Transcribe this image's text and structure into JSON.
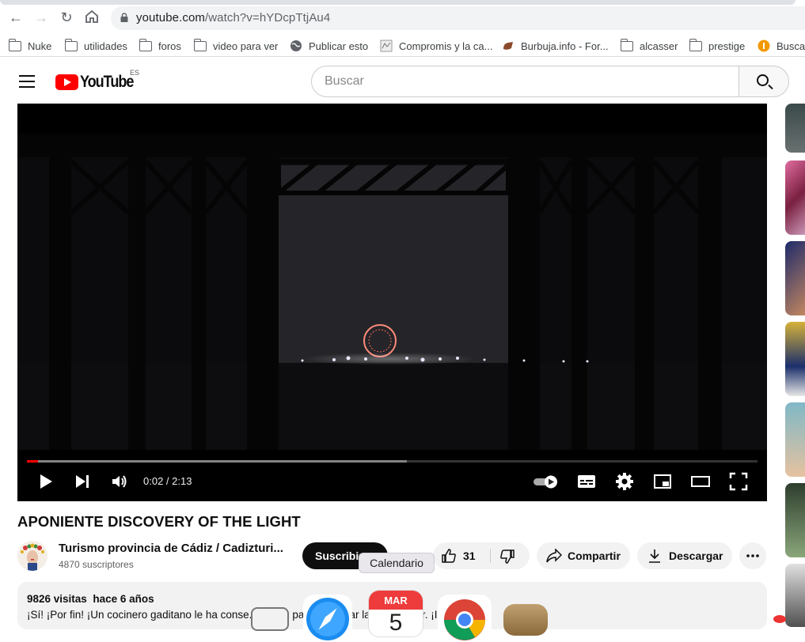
{
  "browser": {
    "url_host": "youtube.com",
    "url_path": "/watch?v=hYDcpTtjAu4",
    "bookmarks": [
      {
        "label": "Nuke",
        "icon": "folder-icon"
      },
      {
        "label": "utilidades",
        "icon": "folder-icon"
      },
      {
        "label": "foros",
        "icon": "folder-icon"
      },
      {
        "label": "video para ver",
        "icon": "folder-icon"
      },
      {
        "label": "Publicar esto",
        "icon": "globe-icon"
      },
      {
        "label": "Compromis y la ca...",
        "icon": "site-icon"
      },
      {
        "label": "Burbuja.info - For...",
        "icon": "site-icon"
      },
      {
        "label": "alcasser",
        "icon": "folder-icon"
      },
      {
        "label": "prestige",
        "icon": "folder-icon"
      },
      {
        "label": "Busca",
        "icon": "site-icon"
      }
    ]
  },
  "youtube": {
    "logo_text": "YouTube",
    "region": "ES",
    "search_placeholder": "Buscar"
  },
  "player": {
    "current_time": "0:02",
    "duration": "2:13",
    "time_display": "0:02 / 2:13",
    "played_fraction": 0.015,
    "buffered_fraction": 0.52
  },
  "video": {
    "title": "APONIENTE DISCOVERY OF THE LIGHT",
    "channel": "Turismo provincia de Cádiz / Cadizturi...",
    "subscribers": "4870 suscriptores",
    "subscribe_label": "Suscribirse",
    "likes": "31",
    "share_label": "Compartir",
    "download_label": "Descargar",
    "views": "9826 visitas",
    "age": "hace 6 años",
    "description": "¡Sí! ¡Por fin! ¡Un cocinero gaditano le ha conse... ...iz ... para saborear la luz del mar. ¡Increíble!"
  },
  "dock": {
    "tooltip": "Calendario",
    "calendar_month": "MAR",
    "calendar_day": "5"
  }
}
